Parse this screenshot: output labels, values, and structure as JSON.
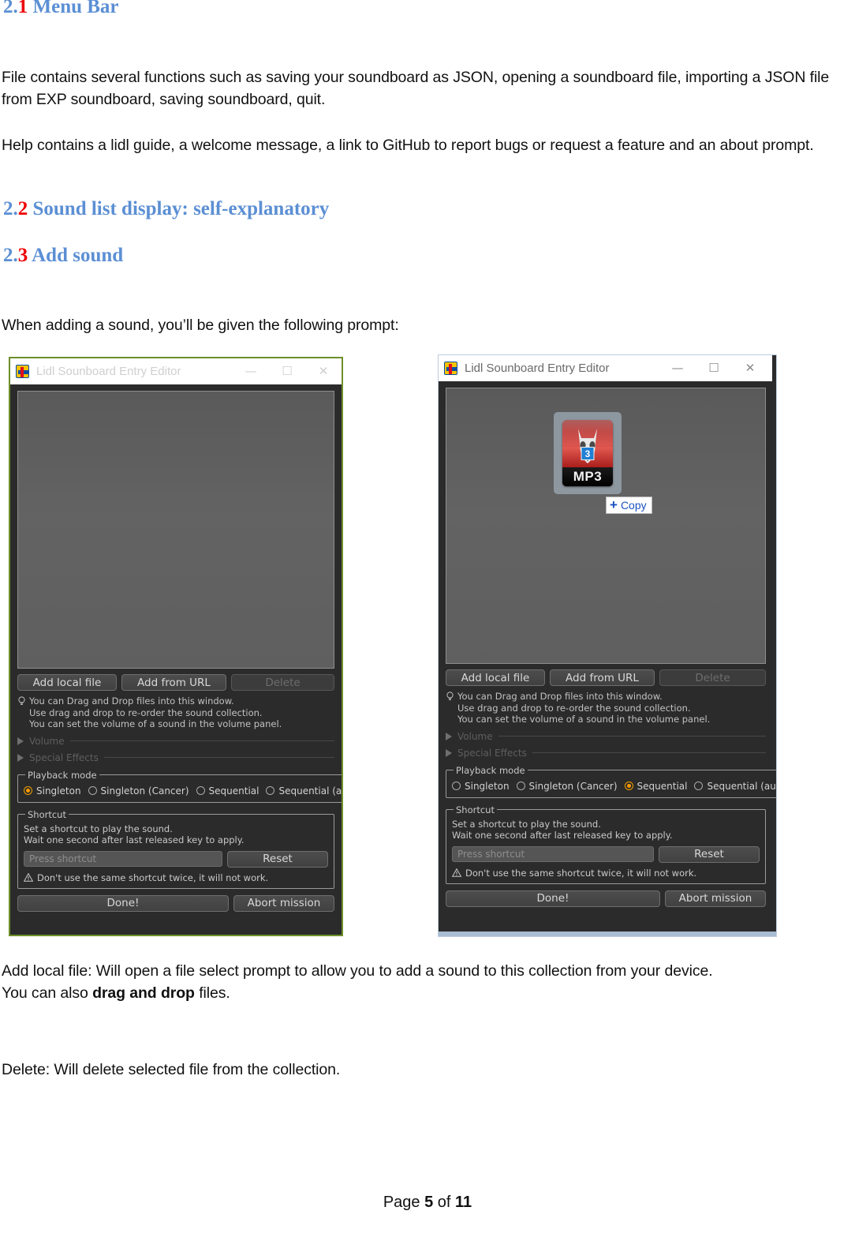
{
  "document": {
    "headings": {
      "h21": {
        "num_main": "2.",
        "num_sub": "1",
        "text": " Menu Bar"
      },
      "h22": {
        "num_main": "2.",
        "num_sub": "2",
        "text": " Sound list display: self-explanatory"
      },
      "h23": {
        "num_main": "2.",
        "num_sub": "3",
        "text": " Add sound"
      }
    },
    "paragraphs": {
      "p1": "File contains several functions such as saving your soundboard as JSON, opening a soundboard file, importing a JSON file from EXP soundboard,  saving soundboard, quit.",
      "p2": "Help contains a lidl guide, a welcome message, a link to GitHub to report bugs or request a feature and an about prompt.",
      "p3": "When adding a sound, you’ll be given the following prompt:",
      "p4_line1": "Add local file: Will open a file select prompt to allow you to add a sound to this collection from your device.",
      "p4_line2_a": "You can also ",
      "p4_line2_bold": "drag and drop",
      "p4_line2_b": " files.",
      "p5": "Delete: Will delete selected file from the collection."
    },
    "footer": {
      "prefix": "Page ",
      "page": "5",
      "middle": " of ",
      "total": "11"
    }
  },
  "dialog_left": {
    "title": "Lidl Sounboard Entry Editor",
    "window_controls": {
      "minimize": "—",
      "maximize": "☐",
      "close": "✕"
    },
    "buttons": {
      "add_local_file": "Add local file",
      "add_from_url": "Add from URL",
      "delete": "Delete"
    },
    "hint": {
      "line1": "You can Drag and Drop files into this window.",
      "line2": "Use drag and drop to re-order the sound collection.",
      "line3": "You can set the volume of a sound in the volume panel."
    },
    "collapsibles": {
      "volume": "Volume",
      "special_effects": "Special Effects"
    },
    "playback_mode": {
      "legend": "Playback mode",
      "options": [
        "Singleton",
        "Singleton (Cancer)",
        "Sequential",
        "Sequential (auto)"
      ],
      "selected": "Singleton"
    },
    "shortcut": {
      "legend": "Shortcut",
      "line1": "Set a shortcut to play the sound.",
      "line2": "Wait one second after last released key to apply.",
      "input_placeholder": "Press shortcut",
      "reset_label": "Reset",
      "warning": "Don't use the same shortcut twice, it will not work."
    },
    "final_buttons": {
      "done": "Done!",
      "abort": "Abort mission"
    },
    "accent_border": "#6d8f2a"
  },
  "dialog_right": {
    "title": "Lidl Sounboard Entry Editor",
    "window_controls": {
      "minimize": "—",
      "maximize": "☐",
      "close": "✕"
    },
    "sound_item": {
      "type_label": "MP3",
      "badge": "3",
      "drag_tooltip": "Copy",
      "drag_plus": "+"
    },
    "buttons": {
      "add_local_file": "Add local file",
      "add_from_url": "Add from URL",
      "delete": "Delete"
    },
    "hint": {
      "line1": "You can Drag and Drop files into this window.",
      "line2": "Use drag and drop to re-order the sound collection.",
      "line3": "You can set the volume of a sound in the volume panel."
    },
    "collapsibles": {
      "volume": "Volume",
      "special_effects": "Special Effects"
    },
    "playback_mode": {
      "legend": "Playback mode",
      "options": [
        "Singleton",
        "Singleton (Cancer)",
        "Sequential",
        "Sequential (auto)"
      ],
      "selected": "Sequential"
    },
    "shortcut": {
      "legend": "Shortcut",
      "line1": "Set a shortcut to play the sound.",
      "line2": "Wait one second after last released key to apply.",
      "input_placeholder": "Press shortcut",
      "reset_label": "Reset",
      "warning": "Don't use the same shortcut twice, it will not work."
    },
    "final_buttons": {
      "done": "Done!",
      "abort": "Abort mission"
    }
  }
}
